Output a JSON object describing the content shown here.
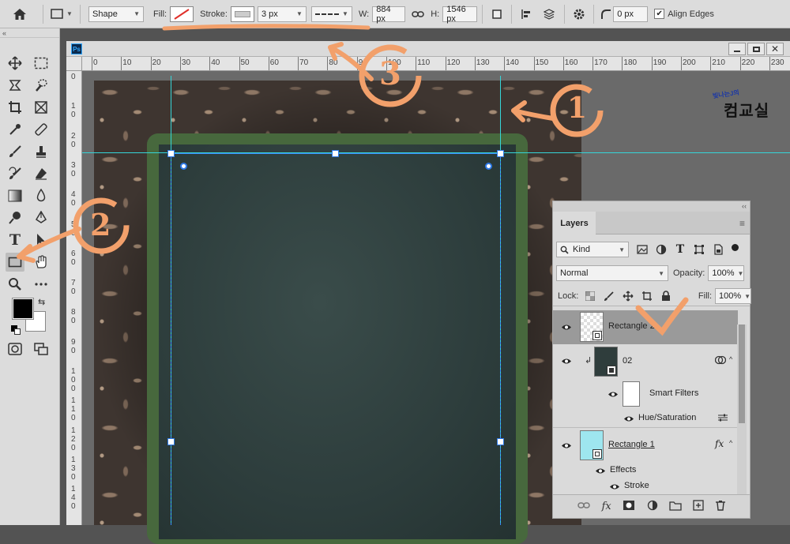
{
  "options_bar": {
    "tool_mode": "Shape",
    "fill_label": "Fill:",
    "stroke_label": "Stroke:",
    "stroke_width": "3 px",
    "w_label": "W:",
    "w_value": "884 px",
    "h_label": "H:",
    "h_value": "1546 px",
    "radius_value": "0 px",
    "align_edges_label": "Align Edges",
    "align_edges_checked": true
  },
  "toolbar": {
    "collapse_label": "«"
  },
  "document": {
    "ps_badge": "Ps",
    "ruler_h": [
      "0",
      "10",
      "20",
      "30",
      "40",
      "50",
      "60",
      "70",
      "80",
      "90",
      "100",
      "110",
      "120",
      "130",
      "140",
      "150",
      "160",
      "170",
      "180",
      "190",
      "200",
      "210",
      "220",
      "230"
    ],
    "ruler_v": [
      "0",
      "1\n0",
      "2\n0",
      "3\n0",
      "4\n0",
      "5\n0",
      "6\n0",
      "7\n0",
      "8\n0",
      "9\n0",
      "1\n0\n0",
      "1\n1\n0",
      "1\n2\n0",
      "1\n3\n0",
      "1\n4\n0"
    ]
  },
  "logo": {
    "small_text": "빛나는J의",
    "big_text": "컴교실"
  },
  "layers_panel": {
    "collapse_label": "‹‹",
    "tab_label": "Layers",
    "kind_label": "Kind",
    "blend_mode": "Normal",
    "opacity_label": "Opacity:",
    "opacity_value": "100%",
    "lock_label": "Lock:",
    "fill_label": "Fill:",
    "fill_value": "100%",
    "layers": [
      {
        "name": "Rectangle 2",
        "selected": true
      },
      {
        "name": "02",
        "selected": false
      },
      {
        "name": "Smart Filters",
        "selected": false
      },
      {
        "name": "Hue/Saturation",
        "selected": false
      },
      {
        "name": "Rectangle 1",
        "selected": false,
        "fx": "fx"
      },
      {
        "name": "Effects",
        "selected": false
      },
      {
        "name": "Stroke",
        "selected": false
      }
    ],
    "footer_fx": "fx"
  },
  "colors": {
    "annotation": "#f2a06b",
    "guide": "#35d6d9",
    "selection": "#2f7be8",
    "frame_green": "#47683d",
    "chalkboard": "#2d3d3c"
  },
  "annotations": [
    "1",
    "2",
    "3"
  ]
}
